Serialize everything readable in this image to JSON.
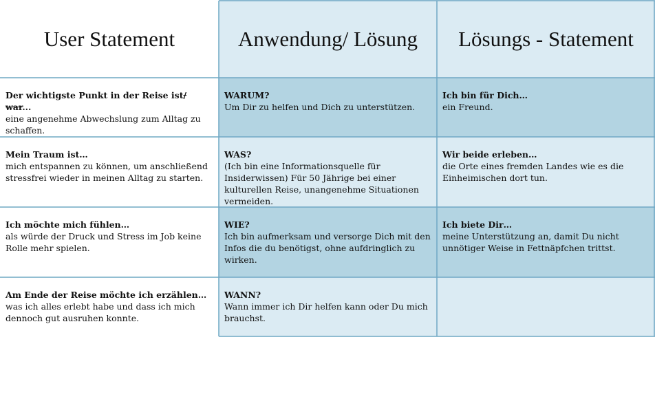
{
  "headers": {
    "col1": "User Statement",
    "col2": "Anwendung/ Lösung",
    "col3": "Lösungs - Statement"
  },
  "rows": [
    {
      "user_title_a": "Der wichtigste Punkt in der Reise ist",
      "user_title_strike": "/ war",
      "user_title_b": "...",
      "user_text": "eine angenehme Abwechslung zum Alltag zu schaffen.",
      "app_title": "WARUM?",
      "app_text": "Um Dir zu helfen und Dich zu unterstützen.",
      "sol_title": "Ich bin für Dich…",
      "sol_text": "ein Freund."
    },
    {
      "user_title": "Mein Traum ist…",
      "user_text": "mich entspannen zu können, um anschließend stressfrei wieder in meinen Alltag zu starten.",
      "app_title": "WAS?",
      "app_text": "(Ich bin eine Informationsquelle für Insiderwissen) Für 50 Jährige bei einer kulturellen Reise, unangenehme Situationen vermeiden.",
      "sol_title": "Wir beide erleben…",
      "sol_text": "die Orte eines fremden Landes wie es die Einheimischen dort tun."
    },
    {
      "user_title": "Ich möchte mich fühlen…",
      "user_text": "als würde der Druck und Stress im Job keine Rolle mehr spielen.",
      "app_title": "WIE?",
      "app_text": "Ich bin aufmerksam und versorge Dich mit den Infos die du benötigst, ohne aufdringlich zu wirken.",
      "sol_title": "Ich biete Dir…",
      "sol_text": "meine Unterstützung an, damit Du nicht unnötiger Weise in Fettnäpfchen trittst."
    },
    {
      "user_title": "Am Ende der Reise möchte ich erzählen…",
      "user_text": "was ich alles erlebt habe und dass ich mich dennoch gut ausruhen konnte.",
      "app_title": "WANN?",
      "app_text": "Wann immer ich Dir helfen kann oder Du mich brauchst.",
      "sol_title": "",
      "sol_text": ""
    }
  ],
  "colors": {
    "light_cell": "#dbebf3",
    "dark_cell": "#b3d4e2",
    "border": "#6fa8c4"
  }
}
